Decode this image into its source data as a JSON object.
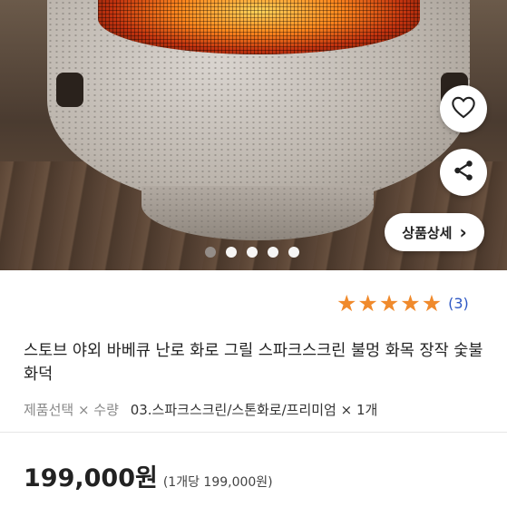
{
  "product": {
    "title": "스토브 야외 바베큐 난로 화로 그릴 스파크스크린 불멍 화목 장작 숯불 화덕",
    "rating_stars": 5,
    "review_count": "(3)",
    "options": {
      "label": "제품선택 × 수량",
      "value": "03.스파크스크린/스톤화로/프리미엄 × 1개"
    },
    "price": "199,000원",
    "unit_price": "(1개당 199,000원)"
  },
  "hero": {
    "detail_button_label": "상품상세",
    "detail_button_arrow": "›",
    "pagination": {
      "total": 5,
      "active_index": 0
    },
    "icons": [
      "heart-icon",
      "share-icon"
    ]
  },
  "colors": {
    "star": "#f08a2c",
    "review_link": "#2d57c4",
    "text": "#222222"
  }
}
